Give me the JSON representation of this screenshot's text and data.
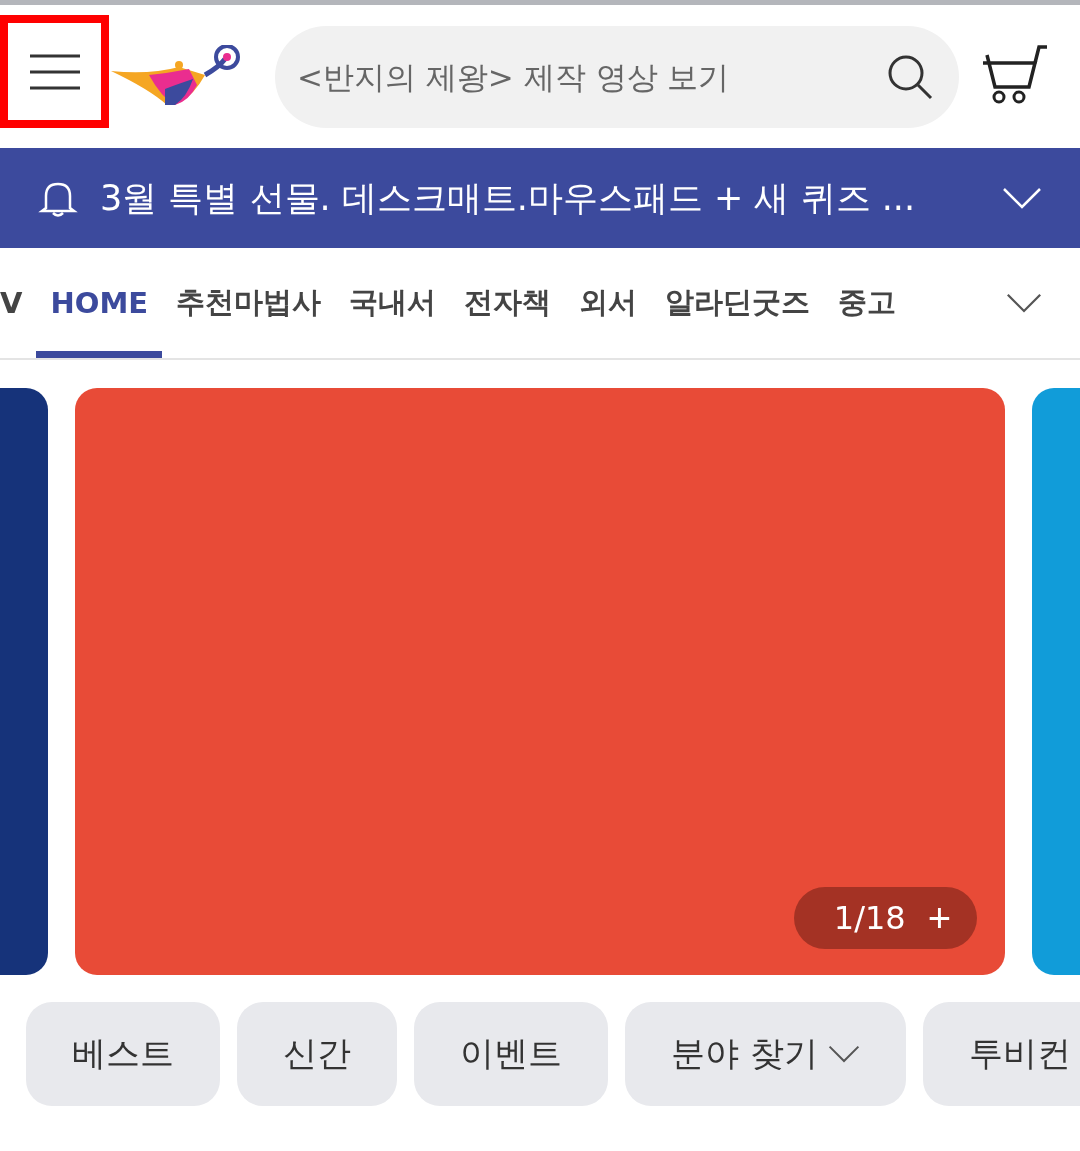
{
  "header": {
    "menu_highlighted": true,
    "search": {
      "placeholder": "<반지의 제왕> 제작 영상 보기"
    }
  },
  "notice": {
    "text": "3월 특별 선물. 데스크매트.마우스패드 + 새 퀴즈 ..."
  },
  "tabs": [
    {
      "label": "V",
      "selected": false
    },
    {
      "label": "HOME",
      "selected": true
    },
    {
      "label": "추천마법사",
      "selected": false
    },
    {
      "label": "국내서",
      "selected": false
    },
    {
      "label": "전자책",
      "selected": false
    },
    {
      "label": "외서",
      "selected": false
    },
    {
      "label": "알라딘굿즈",
      "selected": false
    },
    {
      "label": "중고",
      "selected": false
    }
  ],
  "carousel": {
    "slides": [
      {
        "color": "#16337a"
      },
      {
        "color": "#e84b37"
      },
      {
        "color": "#119cd9"
      }
    ],
    "counter": "1/18",
    "more": "+"
  },
  "chips": [
    {
      "label": "베스트",
      "kind": "plain"
    },
    {
      "label": "신간",
      "kind": "plain"
    },
    {
      "label": "이벤트",
      "kind": "plain"
    },
    {
      "label": "분야 찾기",
      "kind": "dropdown"
    },
    {
      "label": "투비컨",
      "kind": "plain"
    }
  ]
}
